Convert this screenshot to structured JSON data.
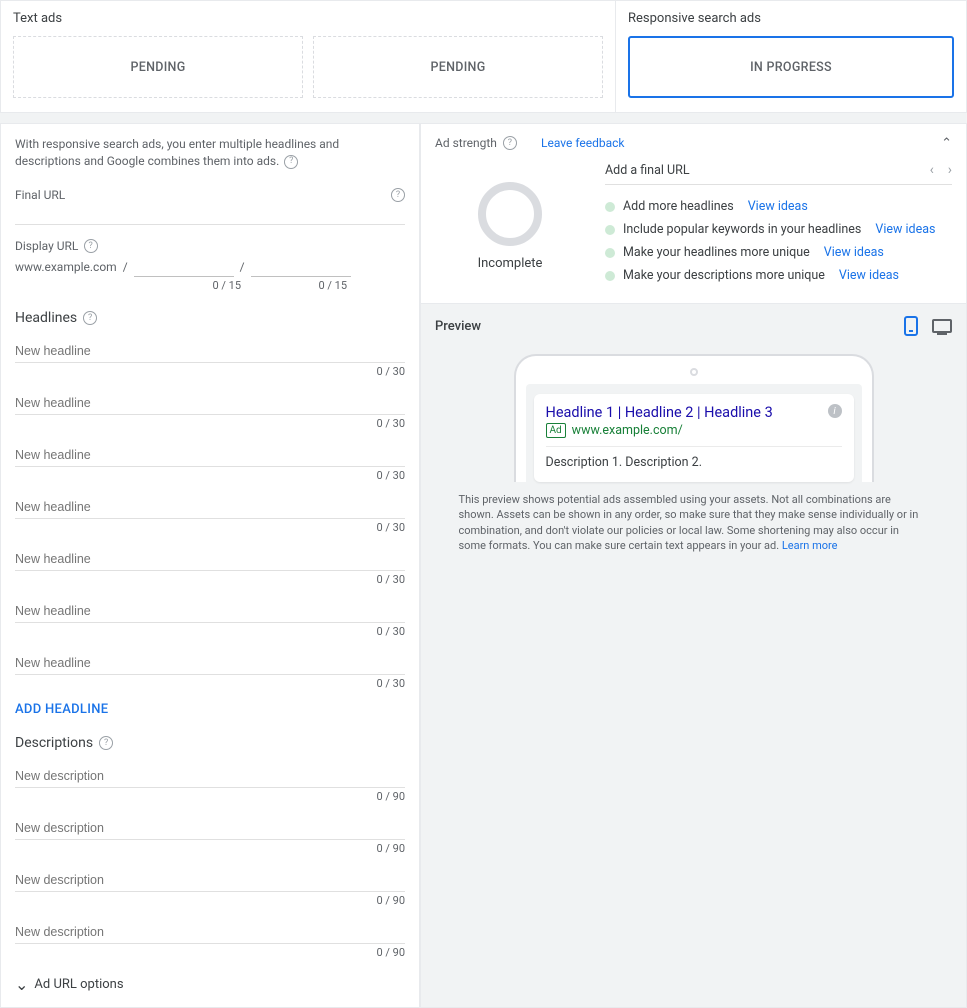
{
  "top": {
    "text_ads_label": "Text ads",
    "responsive_label": "Responsive search ads",
    "pending_label": "PENDING",
    "inprogress_label": "IN PROGRESS"
  },
  "form": {
    "intro": "With responsive search ads, you enter multiple headlines and descriptions and Google combines them into ads.",
    "final_url_label": "Final URL",
    "display_url_label": "Display URL",
    "display_url_base": "www.example.com",
    "path_counter": "0 / 15",
    "headlines_label": "Headlines",
    "headline_placeholder": "New headline",
    "headline_counter": "0 / 30",
    "headline_count": 7,
    "add_headline": "ADD HEADLINE",
    "descriptions_label": "Descriptions",
    "description_placeholder": "New description",
    "description_counter": "0 / 90",
    "description_count": 4,
    "url_options": "Ad URL options"
  },
  "strength": {
    "title": "Ad strength",
    "leave_feedback": "Leave feedback",
    "status": "Incomplete",
    "top_recommendation": "Add a final URL",
    "items": [
      {
        "text": "Add more headlines",
        "link": "View ideas"
      },
      {
        "text": "Include popular keywords in your headlines",
        "link": "View ideas"
      },
      {
        "text": "Make your headlines more unique",
        "link": "View ideas"
      },
      {
        "text": "Make your descriptions more unique",
        "link": "View ideas"
      }
    ]
  },
  "preview": {
    "title": "Preview",
    "ad_headline": "Headline 1 | Headline 2 | Headline 3",
    "ad_badge": "Ad",
    "ad_url": "www.example.com/",
    "ad_description": "Description 1. Description 2.",
    "note_before": "This preview shows potential ads assembled using your assets. Not all combinations are shown. Assets can be shown in any order, so make sure that they make sense individually or in combination, and don't violate our policies or local law. Some shortening may also occur in some formats. You can make sure certain text appears in your ad. ",
    "learn_more": "Learn more"
  }
}
